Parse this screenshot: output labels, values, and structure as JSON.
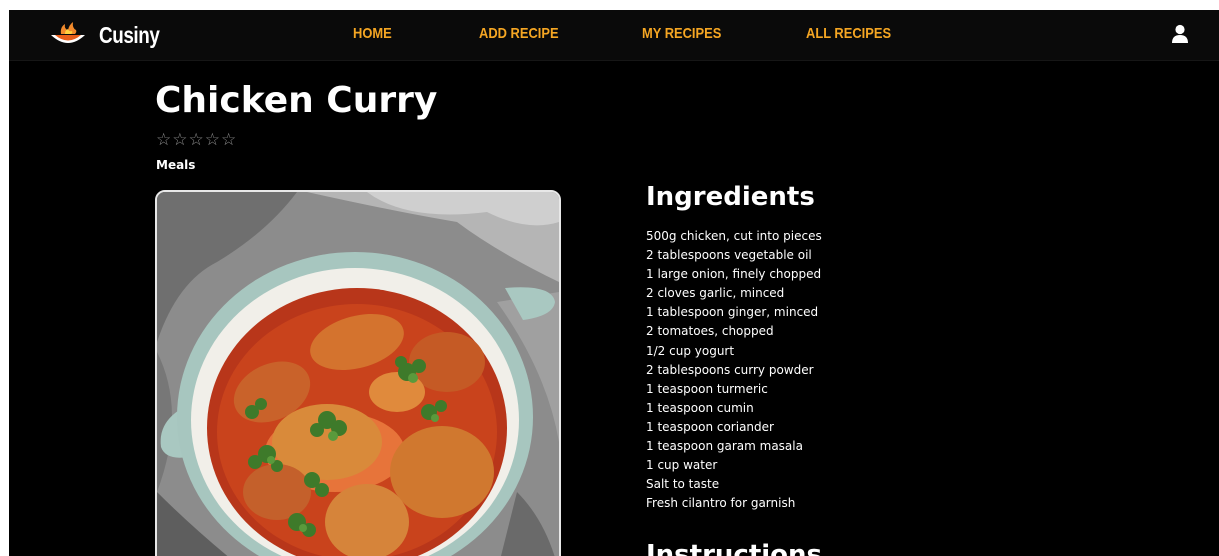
{
  "brand": {
    "name": "Cusiny",
    "logo_icon": "flaming-pot-icon"
  },
  "nav": {
    "links": [
      {
        "label": "HOME"
      },
      {
        "label": "ADD RECIPE"
      },
      {
        "label": "MY RECIPES"
      },
      {
        "label": "ALL RECIPES"
      }
    ],
    "link_color": "#f5a623",
    "user_icon": "user-icon"
  },
  "recipe": {
    "title": "Chicken Curry",
    "rating": {
      "value": 0,
      "max": 5,
      "icon": "star-outline-icon"
    },
    "category": "Meals",
    "image_icon": "chicken-curry-photo",
    "ingredients_heading": "Ingredients",
    "ingredients": [
      "500g chicken, cut into pieces",
      "2 tablespoons vegetable oil",
      "1 large onion, finely chopped",
      "2 cloves garlic, minced",
      "1 tablespoon ginger, minced",
      "2 tomatoes, chopped",
      "1/2 cup yogurt",
      "2 tablespoons curry powder",
      "1 teaspoon turmeric",
      "1 teaspoon cumin",
      "1 teaspoon coriander",
      "1 teaspoon garam masala",
      "1 cup water",
      "Salt to taste",
      "Fresh cilantro for garnish"
    ],
    "instructions_heading": "Instructions"
  },
  "colors": {
    "background": "#000000",
    "navbar": "#0a0a0a",
    "accent": "#f5a623",
    "text": "#ffffff"
  }
}
